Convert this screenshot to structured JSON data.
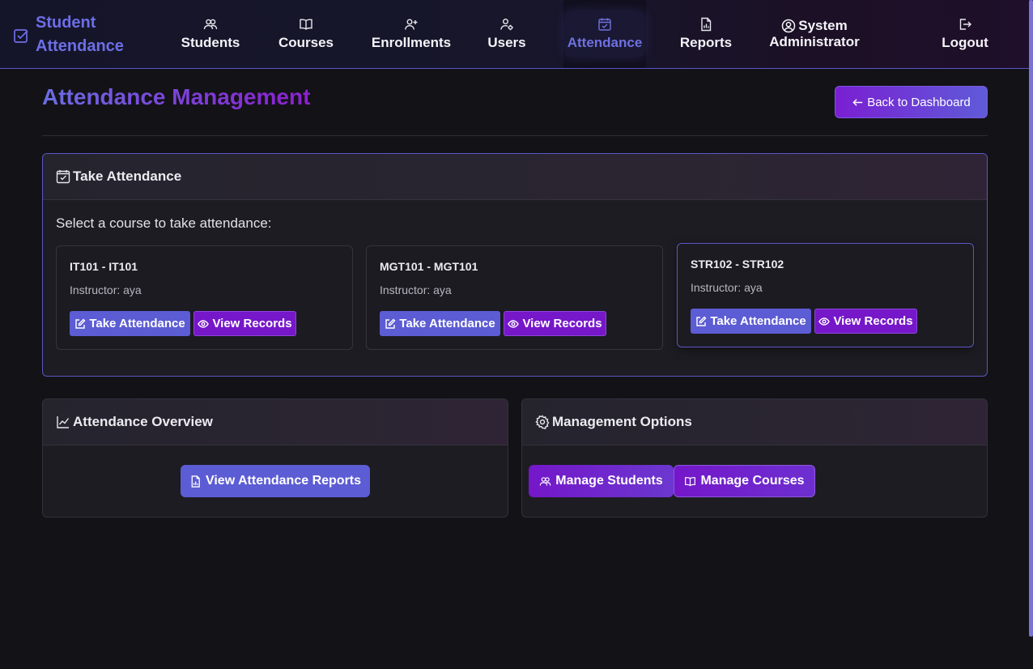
{
  "brand": {
    "line1": "Student",
    "line2": "Attendance"
  },
  "nav": {
    "students": "Students",
    "courses": "Courses",
    "enrollments": "Enrollments",
    "users": "Users",
    "attendance": "Attendance",
    "reports": "Reports",
    "user_line1": "System",
    "user_line2": "Administrator",
    "logout": "Logout"
  },
  "page": {
    "title": "Attendance Management",
    "back_label": "Back to Dashboard"
  },
  "take_attendance": {
    "header": "Take Attendance",
    "prompt": "Select a course to take attendance:",
    "take_label": "Take Attendance",
    "view_label": "View Records",
    "courses": [
      {
        "title": "IT101 - IT101",
        "instructor": "Instructor: aya"
      },
      {
        "title": "MGT101 - MGT101",
        "instructor": "Instructor: aya"
      },
      {
        "title": "STR102 - STR102",
        "instructor": "Instructor: aya"
      }
    ]
  },
  "overview": {
    "header": "Attendance Overview",
    "reports_label": "View Attendance Reports"
  },
  "management": {
    "header": "Management Options",
    "students_label": "Manage Students",
    "courses_label": "Manage Courses"
  },
  "colors": {
    "accent": "#5c5cd4",
    "purple": "#7617c9",
    "background": "#131217"
  }
}
